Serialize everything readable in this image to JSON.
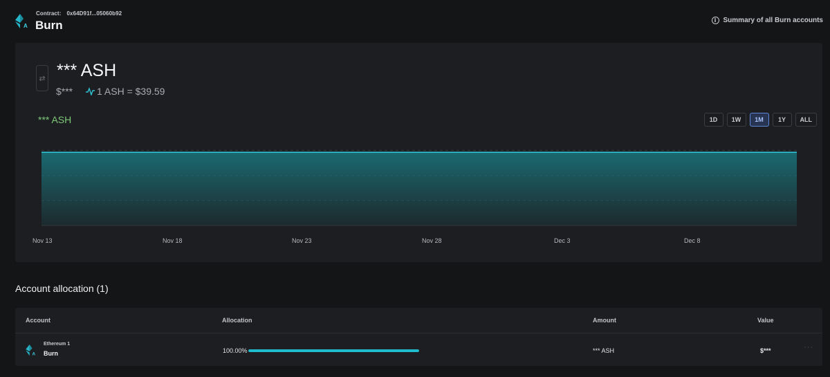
{
  "header": {
    "contract_label": "Contract:",
    "contract_address": "0x64D91f...05060b92",
    "title": "Burn",
    "summary_link": "Summary of all Burn accounts"
  },
  "balance": {
    "amount": "*** ASH",
    "usd": "$***",
    "rate": "1 ASH = $39.59"
  },
  "chart_header": {
    "label": "*** ASH",
    "ranges": [
      "1D",
      "1W",
      "1M",
      "1Y",
      "ALL"
    ],
    "active_range": "1M"
  },
  "chart_data": {
    "type": "area",
    "x": [
      "Nov 13",
      "Nov 18",
      "Nov 23",
      "Nov 28",
      "Dec 3",
      "Dec 8"
    ],
    "series": [
      {
        "values": [
          1,
          1,
          1,
          1,
          1,
          1
        ]
      }
    ],
    "x_tick_labels": [
      "Nov 13",
      "Nov 18",
      "Nov 23",
      "Nov 28",
      "Dec 3",
      "Dec 8"
    ],
    "ylim": [
      0,
      1.2
    ],
    "grid": true,
    "line_color": "#2ec4d4",
    "fill_color": "#1a6d74"
  },
  "allocation": {
    "title": "Account allocation (1)",
    "columns": {
      "account": "Account",
      "allocation": "Allocation",
      "amount": "Amount",
      "value": "Value"
    },
    "rows": [
      {
        "network": "Ethereum 1",
        "name": "Burn",
        "allocation_pct": "100.00%",
        "allocation_fraction": 1.0,
        "amount": "*** ASH",
        "value": "$***",
        "more": "···"
      }
    ]
  },
  "colors": {
    "background": "#141517",
    "card": "#1d1e21",
    "accent": "#1fbccd",
    "balance_green": "#7fc97a",
    "active_range": "#5f87d8"
  }
}
